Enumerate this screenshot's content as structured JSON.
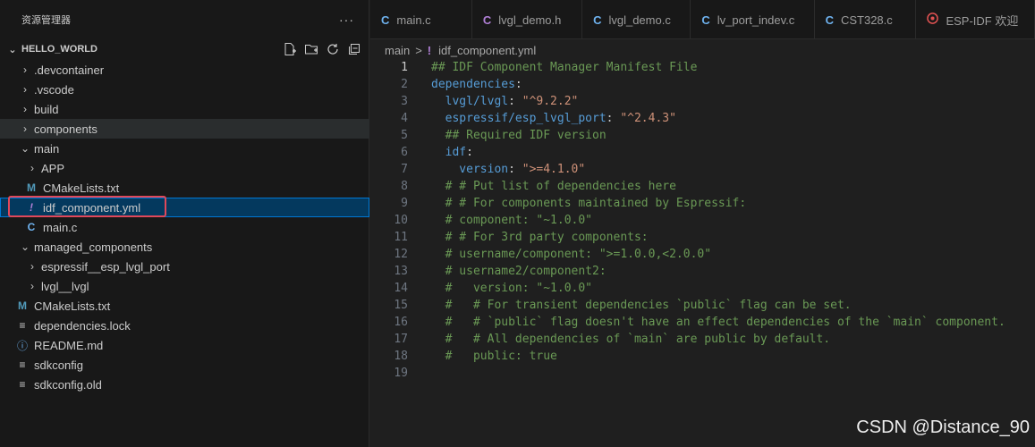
{
  "sidebar": {
    "title": "资源管理器",
    "more": "···",
    "section": "HELLO_WORLD",
    "tree": [
      {
        "label": ".devcontainer",
        "type": "folder",
        "expanded": false,
        "depth": 0
      },
      {
        "label": ".vscode",
        "type": "folder",
        "expanded": false,
        "depth": 0
      },
      {
        "label": "build",
        "type": "folder",
        "expanded": false,
        "depth": 0
      },
      {
        "label": "components",
        "type": "folder",
        "expanded": false,
        "depth": 0
      },
      {
        "label": "main",
        "type": "folder",
        "expanded": true,
        "depth": 0
      },
      {
        "label": "APP",
        "type": "folder",
        "expanded": false,
        "depth": 1
      },
      {
        "label": "CMakeLists.txt",
        "type": "cmake",
        "depth": 1
      },
      {
        "label": "idf_component.yml",
        "type": "yml",
        "depth": 1
      },
      {
        "label": "main.c",
        "type": "c",
        "depth": 1
      },
      {
        "label": "managed_components",
        "type": "folder",
        "expanded": true,
        "depth": 0
      },
      {
        "label": "espressif__esp_lvgl_port",
        "type": "folder",
        "expanded": false,
        "depth": 1
      },
      {
        "label": "lvgl__lvgl",
        "type": "folder",
        "expanded": false,
        "depth": 1
      },
      {
        "label": "CMakeLists.txt",
        "type": "cmake",
        "depth": 0
      },
      {
        "label": "dependencies.lock",
        "type": "lines",
        "depth": 0
      },
      {
        "label": "README.md",
        "type": "info",
        "depth": 0
      },
      {
        "label": "sdkconfig",
        "type": "lines",
        "depth": 0
      },
      {
        "label": "sdkconfig.old",
        "type": "lines",
        "depth": 0
      }
    ]
  },
  "tabs": [
    {
      "label": "main.c",
      "icon": "C"
    },
    {
      "label": "lvgl_demo.h",
      "icon": "C"
    },
    {
      "label": "lvgl_demo.c",
      "icon": "C"
    },
    {
      "label": "lv_port_indev.c",
      "icon": "C"
    },
    {
      "label": "CST328.c",
      "icon": "C"
    },
    {
      "label": "ESP-IDF 欢迎",
      "icon": "esp"
    }
  ],
  "breadcrumb": {
    "folder": "main",
    "separator": ">",
    "file": "idf_component.yml",
    "file_icon": "!"
  },
  "code": {
    "lines": [
      {
        "n": "1",
        "text": "## IDF Component Manager Manifest File"
      },
      {
        "n": "2",
        "text": "dependencies:"
      },
      {
        "n": "3",
        "text": "  lvgl/lvgl: \"^9.2.2\""
      },
      {
        "n": "4",
        "text": "  espressif/esp_lvgl_port: \"^2.4.3\""
      },
      {
        "n": "5",
        "text": "  ## Required IDF version"
      },
      {
        "n": "6",
        "text": "  idf:"
      },
      {
        "n": "7",
        "text": "    version: \">=4.1.0\""
      },
      {
        "n": "8",
        "text": "  # # Put list of dependencies here"
      },
      {
        "n": "9",
        "text": "  # # For components maintained by Espressif:"
      },
      {
        "n": "10",
        "text": "  # component: \"~1.0.0\""
      },
      {
        "n": "11",
        "text": "  # # For 3rd party components:"
      },
      {
        "n": "12",
        "text": "  # username/component: \">=1.0.0,<2.0.0\""
      },
      {
        "n": "13",
        "text": "  # username2/component2:"
      },
      {
        "n": "14",
        "text": "  #   version: \"~1.0.0\""
      },
      {
        "n": "15",
        "text": "  #   # For transient dependencies `public` flag can be set."
      },
      {
        "n": "16",
        "text": "  #   # `public` flag doesn't have an effect dependencies of the `main` component."
      },
      {
        "n": "17",
        "text": "  #   # All dependencies of `main` are public by default."
      },
      {
        "n": "18",
        "text": "  #   public: true"
      },
      {
        "n": "19",
        "text": ""
      }
    ]
  },
  "watermark": "CSDN @Distance_90",
  "colors": {
    "comment": "#6a9955",
    "key": "#569cd6",
    "string": "#ce9178",
    "selection_outline": "#0078d4",
    "highlight_box": "#e0485a"
  }
}
